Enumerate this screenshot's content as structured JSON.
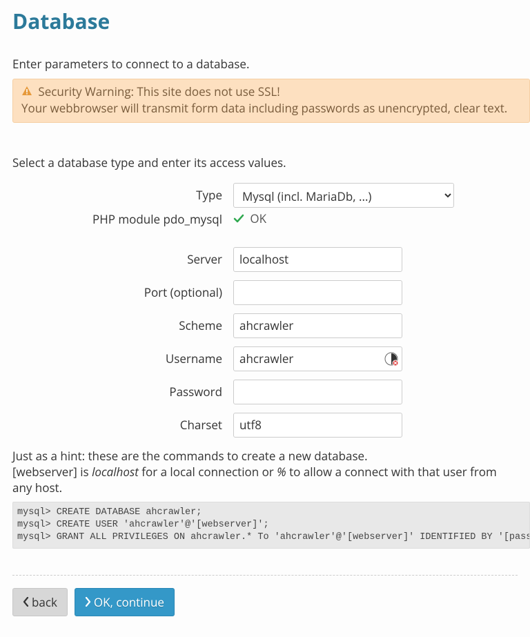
{
  "title": "Database",
  "intro": "Enter parameters to connect to a database.",
  "warning": {
    "line1": "Security Warning: This site does not use SSL!",
    "line2": "Your webbrowser will transmit form data including passwords as unencrypted, clear text."
  },
  "section_intro": "Select a database type and enter its access values.",
  "form": {
    "type_label": "Type",
    "type_selected": "Mysql (incl. MariaDb, ...)",
    "module_label": "PHP module pdo_mysql",
    "module_status": "OK",
    "server_label": "Server",
    "server_value": "localhost",
    "port_label": "Port (optional)",
    "port_value": "",
    "scheme_label": "Scheme",
    "scheme_value": "ahcrawler",
    "username_label": "Username",
    "username_value": "ahcrawler",
    "password_label": "Password",
    "password_value": "",
    "charset_label": "Charset",
    "charset_value": "utf8"
  },
  "hint": {
    "line1": "Just as a hint: these are the commands to create a new database.",
    "prefix": "[webserver] is ",
    "em1": "localhost",
    "mid": " for a local connection or ",
    "em2": "%",
    "suffix": " to allow a connect with that user from any host."
  },
  "code": "mysql> CREATE DATABASE ahcrawler;\nmysql> CREATE USER 'ahcrawler'@'[webserver]';\nmysql> GRANT ALL PRIVILEGES ON ahcrawler.* To 'ahcrawler'@'[webserver]' IDENTIFIED BY '[password]';",
  "buttons": {
    "back": "back",
    "continue": "OK, continue"
  }
}
